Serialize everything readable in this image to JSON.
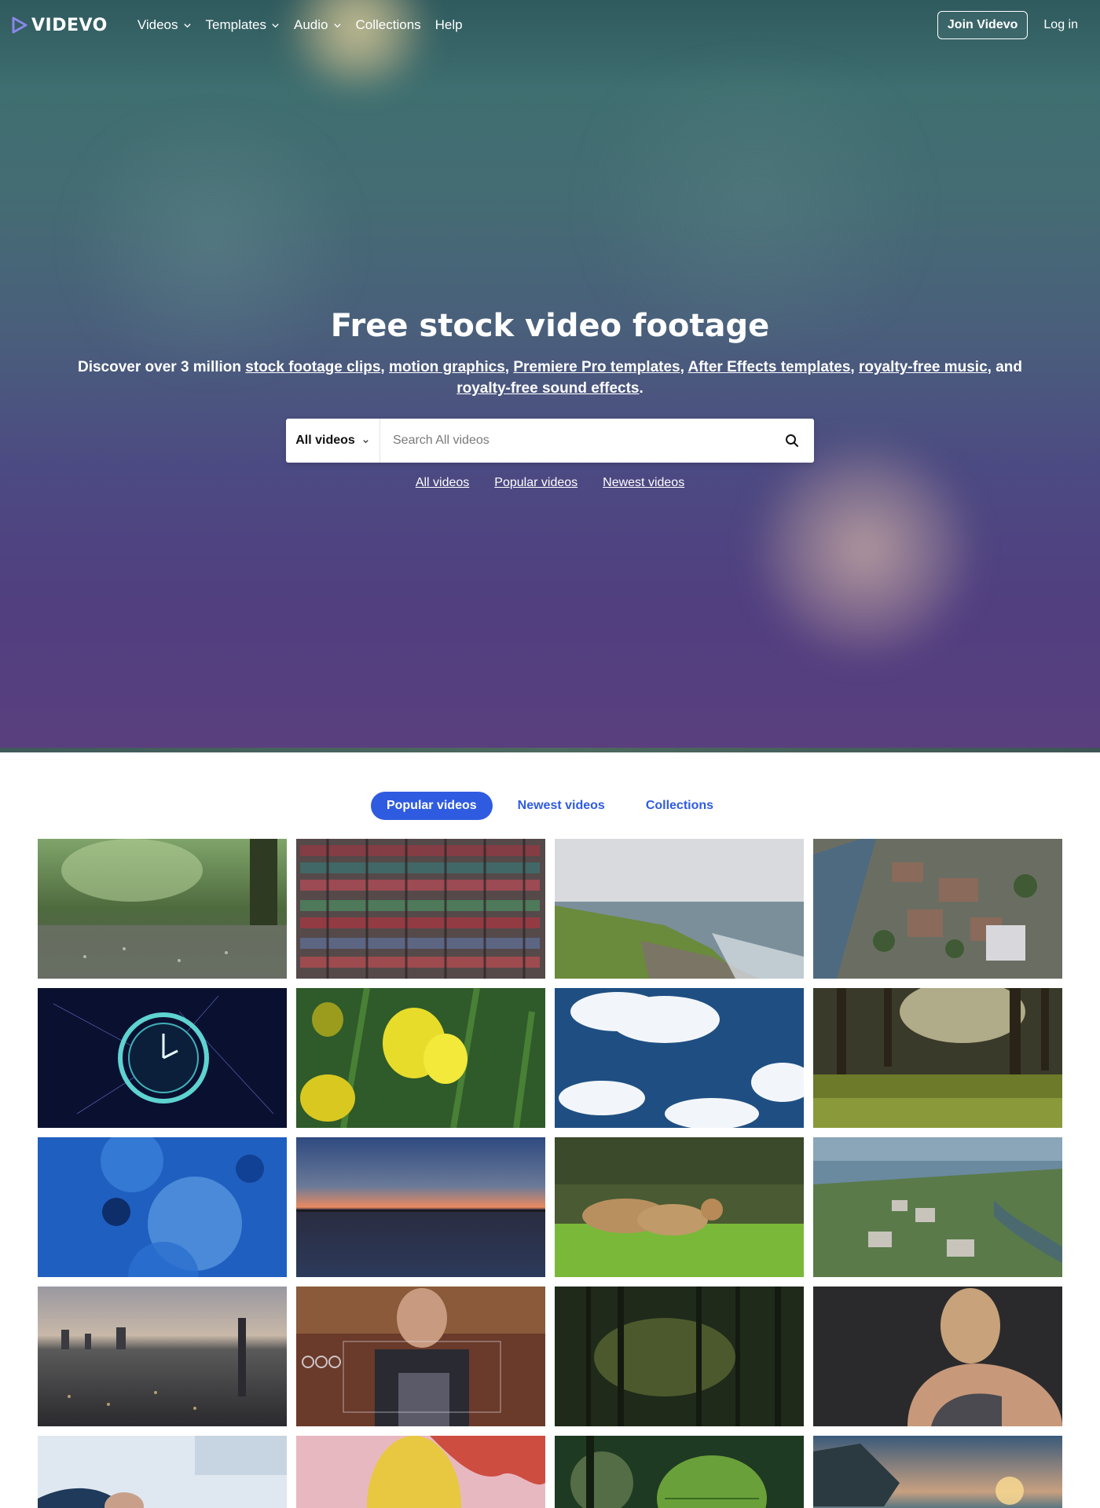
{
  "brand": {
    "name": "VIDEVO"
  },
  "nav": {
    "items": [
      {
        "label": "Videos",
        "dropdown": true
      },
      {
        "label": "Templates",
        "dropdown": true
      },
      {
        "label": "Audio",
        "dropdown": true
      },
      {
        "label": "Collections",
        "dropdown": false
      },
      {
        "label": "Help",
        "dropdown": false
      }
    ],
    "join_label": "Join Videvo",
    "login_label": "Log in"
  },
  "hero": {
    "title": "Free stock video footage",
    "subtitle_prefix": "Discover over 3 million ",
    "links": [
      "stock footage clips",
      "motion graphics",
      "Premiere Pro templates",
      "After Effects templates",
      "royalty-free music",
      "royalty-free sound effects"
    ],
    "subtitle_and": ", and ",
    "subtitle_end": "."
  },
  "search": {
    "category": "All videos",
    "placeholder": "Search All videos"
  },
  "quick_links": [
    "All videos",
    "Popular videos",
    "Newest videos"
  ],
  "tabs": [
    {
      "label": "Popular videos",
      "active": true
    },
    {
      "label": "Newest videos",
      "active": false
    },
    {
      "label": "Collections",
      "active": false
    }
  ],
  "thumbnails": [
    "rain-forest-puddle",
    "shipping-containers-aerial",
    "coastal-cliffs",
    "campus-aerial",
    "digital-clock",
    "yellow-daffodils",
    "blue-sky-clouds",
    "forest-grass-sunlight",
    "blue-cells",
    "sunset-over-water",
    "lionesses-walking",
    "coastal-town-aerial",
    "city-skyline-dusk",
    "man-in-apron-hud",
    "misty-forest",
    "woman-shoulder-portrait",
    "business-hands",
    "woman-dancing",
    "green-leaf",
    "sunset-bay"
  ],
  "colors": {
    "accent": "#2f5be0"
  }
}
